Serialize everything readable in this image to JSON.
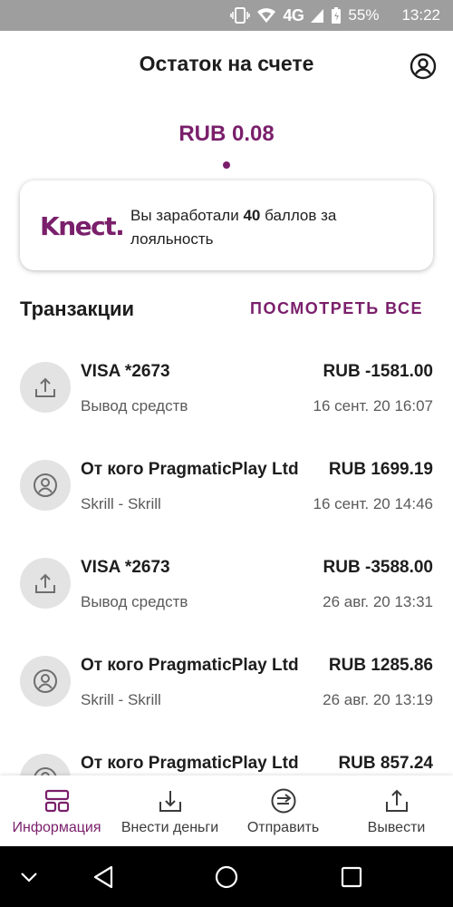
{
  "status_bar": {
    "network": "4G",
    "battery": "55%",
    "time": "13:22"
  },
  "header": {
    "title": "Остаток на счете",
    "profile_icon": "account-circle-icon"
  },
  "balance": {
    "amount": "RUB 0.08"
  },
  "loyalty": {
    "brand": "Knect.",
    "text_before": "Вы заработали ",
    "points": "40",
    "text_after": " баллов за лояльность"
  },
  "transactions": {
    "title": "Транзакции",
    "view_all": "ПОСМОТРЕТЬ ВСЕ",
    "items": [
      {
        "icon": "upload-icon",
        "name": "VISA *2673",
        "amount": "RUB -1581.00",
        "description": "Вывод средств",
        "date": "16 сент. 20 16:07"
      },
      {
        "icon": "person-icon",
        "name": "От кого PragmaticPlay Ltd",
        "amount": "RUB 1699.19",
        "description": "Skrill - Skrill",
        "date": "16 сент. 20 14:46"
      },
      {
        "icon": "upload-icon",
        "name": "VISA *2673",
        "amount": "RUB -3588.00",
        "description": "Вывод средств",
        "date": "26 авг. 20 13:31"
      },
      {
        "icon": "person-icon",
        "name": "От кого PragmaticPlay Ltd",
        "amount": "RUB 1285.86",
        "description": "Skrill - Skrill",
        "date": "26 авг. 20 13:19"
      },
      {
        "icon": "person-icon",
        "name": "От кого PragmaticPlay Ltd",
        "amount": "RUB 857.24",
        "description": "",
        "date": ""
      }
    ]
  },
  "bottom_nav": {
    "items": [
      {
        "label": "Информация",
        "icon": "dashboard-icon",
        "active": true
      },
      {
        "label": "Внести деньги",
        "icon": "download-tray-icon",
        "active": false
      },
      {
        "label": "Отправить",
        "icon": "send-arrow-circle-icon",
        "active": false
      },
      {
        "label": "Вывести",
        "icon": "upload-tray-icon",
        "active": false
      }
    ]
  },
  "colors": {
    "accent": "#7a1f6b",
    "status_bar": "#9e9e9e",
    "icon_bg": "#e3e3e3",
    "secondary_text": "#5a5a5a"
  }
}
